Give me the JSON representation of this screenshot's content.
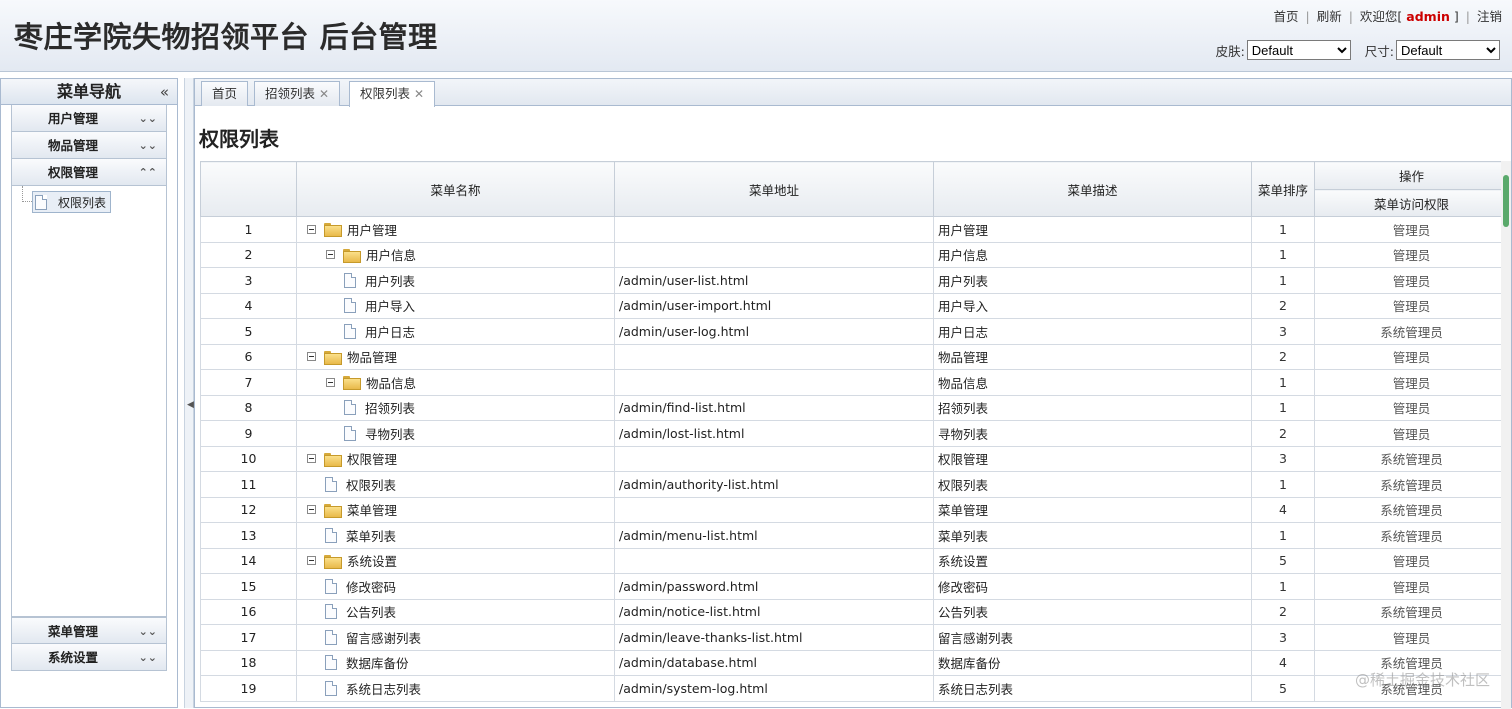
{
  "header": {
    "title": "枣庄学院失物招领平台 后台管理",
    "links": {
      "home": "首页",
      "refresh": "刷新",
      "welcome_prefix": "欢迎您[",
      "user": "admin",
      "welcome_suffix": "]",
      "logout": "注销"
    },
    "skin_label": "皮肤:",
    "skin_value": "Default",
    "size_label": "尺寸:",
    "size_value": "Default"
  },
  "sidebar": {
    "title": "菜单导航",
    "collapse_icon": "«",
    "sections": [
      {
        "label": "用户管理",
        "state": "collapsed"
      },
      {
        "label": "物品管理",
        "state": "collapsed"
      },
      {
        "label": "权限管理",
        "state": "expanded",
        "items": [
          {
            "label": "权限列表"
          }
        ]
      },
      {
        "label": "菜单管理",
        "state": "collapsed"
      },
      {
        "label": "系统设置",
        "state": "collapsed"
      }
    ]
  },
  "tabs": [
    {
      "label": "首页",
      "closable": false
    },
    {
      "label": "招领列表",
      "closable": true
    },
    {
      "label": "权限列表",
      "closable": true,
      "active": true
    }
  ],
  "page_title": "权限列表",
  "table": {
    "headers": {
      "name": "菜单名称",
      "url": "菜单地址",
      "desc": "菜单描述",
      "order": "菜单排序",
      "ops": "操作",
      "access": "菜单访问权限"
    },
    "rows": [
      {
        "num": "1",
        "level": 0,
        "type": "folder",
        "name": "用户管理",
        "url": "",
        "desc": "用户管理",
        "order": "1",
        "perm": "管理员"
      },
      {
        "num": "2",
        "level": 1,
        "type": "folder",
        "name": "用户信息",
        "url": "",
        "desc": "用户信息",
        "order": "1",
        "perm": "管理员"
      },
      {
        "num": "3",
        "level": 2,
        "type": "file",
        "name": "用户列表",
        "url": "/admin/user-list.html",
        "desc": "用户列表",
        "order": "1",
        "perm": "管理员"
      },
      {
        "num": "4",
        "level": 2,
        "type": "file",
        "name": "用户导入",
        "url": "/admin/user-import.html",
        "desc": "用户导入",
        "order": "2",
        "perm": "管理员"
      },
      {
        "num": "5",
        "level": 2,
        "type": "file",
        "name": "用户日志",
        "url": "/admin/user-log.html",
        "desc": "用户日志",
        "order": "3",
        "perm": "系统管理员"
      },
      {
        "num": "6",
        "level": 0,
        "type": "folder",
        "name": "物品管理",
        "url": "",
        "desc": "物品管理",
        "order": "2",
        "perm": "管理员"
      },
      {
        "num": "7",
        "level": 1,
        "type": "folder",
        "name": "物品信息",
        "url": "",
        "desc": "物品信息",
        "order": "1",
        "perm": "管理员"
      },
      {
        "num": "8",
        "level": 2,
        "type": "file",
        "name": "招领列表",
        "url": "/admin/find-list.html",
        "desc": "招领列表",
        "order": "1",
        "perm": "管理员"
      },
      {
        "num": "9",
        "level": 2,
        "type": "file",
        "name": "寻物列表",
        "url": "/admin/lost-list.html",
        "desc": "寻物列表",
        "order": "2",
        "perm": "管理员"
      },
      {
        "num": "10",
        "level": 0,
        "type": "folder",
        "name": "权限管理",
        "url": "",
        "desc": "权限管理",
        "order": "3",
        "perm": "系统管理员"
      },
      {
        "num": "11",
        "level": 1,
        "type": "file",
        "name": "权限列表",
        "url": "/admin/authority-list.html",
        "desc": "权限列表",
        "order": "1",
        "perm": "系统管理员"
      },
      {
        "num": "12",
        "level": 0,
        "type": "folder",
        "name": "菜单管理",
        "url": "",
        "desc": "菜单管理",
        "order": "4",
        "perm": "系统管理员"
      },
      {
        "num": "13",
        "level": 1,
        "type": "file",
        "name": "菜单列表",
        "url": "/admin/menu-list.html",
        "desc": "菜单列表",
        "order": "1",
        "perm": "系统管理员"
      },
      {
        "num": "14",
        "level": 0,
        "type": "folder",
        "name": "系统设置",
        "url": "",
        "desc": "系统设置",
        "order": "5",
        "perm": "管理员"
      },
      {
        "num": "15",
        "level": 1,
        "type": "file",
        "name": "修改密码",
        "url": "/admin/password.html",
        "desc": "修改密码",
        "order": "1",
        "perm": "管理员"
      },
      {
        "num": "16",
        "level": 1,
        "type": "file",
        "name": "公告列表",
        "url": "/admin/notice-list.html",
        "desc": "公告列表",
        "order": "2",
        "perm": "系统管理员"
      },
      {
        "num": "17",
        "level": 1,
        "type": "file",
        "name": "留言感谢列表",
        "url": "/admin/leave-thanks-list.html",
        "desc": "留言感谢列表",
        "order": "3",
        "perm": "管理员"
      },
      {
        "num": "18",
        "level": 1,
        "type": "file",
        "name": "数据库备份",
        "url": "/admin/database.html",
        "desc": "数据库备份",
        "order": "4",
        "perm": "系统管理员"
      },
      {
        "num": "19",
        "level": 1,
        "type": "file",
        "name": "系统日志列表",
        "url": "/admin/system-log.html",
        "desc": "系统日志列表",
        "order": "5",
        "perm": "系统管理员"
      }
    ]
  },
  "watermark": "@稀土掘金技术社区"
}
